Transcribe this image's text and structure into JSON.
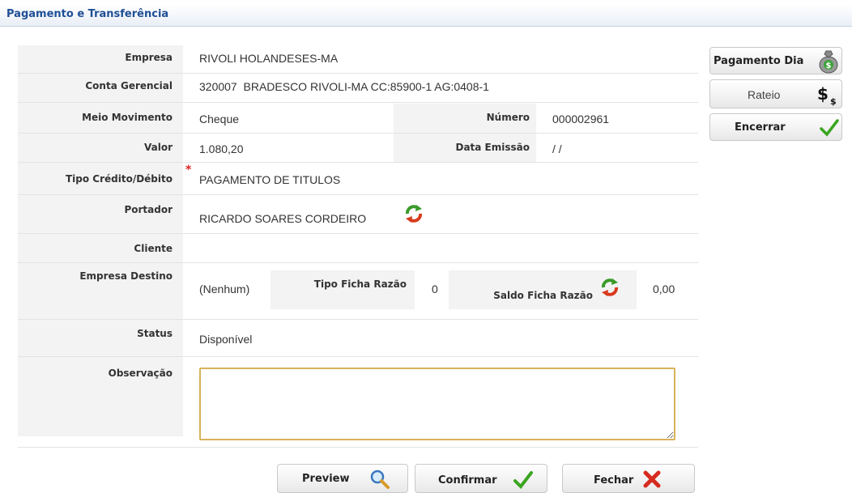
{
  "window": {
    "title": "Pagamento e Transferência"
  },
  "form": {
    "empresa": {
      "label": "Empresa",
      "value": "RIVOLI HOLANDESES-MA"
    },
    "conta_gerencial": {
      "label": "Conta Gerencial",
      "value": "320007  BRADESCO RIVOLI-MA CC:85900-1 AG:0408-1"
    },
    "meio_movimento": {
      "label": "Meio Movimento",
      "value": "Cheque"
    },
    "numero": {
      "label": "Número",
      "value": "000002961"
    },
    "valor": {
      "label": "Valor",
      "value": "1.080,20"
    },
    "data_emissao": {
      "label": "Data Emissão",
      "value": "/ /"
    },
    "tipo_credito_debito": {
      "label": "Tipo Crédito/Débito",
      "value": "PAGAMENTO DE TITULOS",
      "required_mark": "*"
    },
    "portador": {
      "label": "Portador",
      "value": "RICARDO SOARES CORDEIRO"
    },
    "cliente": {
      "label": "Cliente",
      "value": ""
    },
    "empresa_destino": {
      "label": "Empresa Destino",
      "value": "(Nenhum)"
    },
    "tipo_ficha_razao": {
      "label": "Tipo Ficha Razão",
      "value": "0"
    },
    "saldo_ficha_razao": {
      "label": "Saldo Ficha Razão",
      "value": "0,00"
    },
    "status": {
      "label": "Status",
      "value": "Disponível"
    },
    "observacao": {
      "label": "Observação",
      "value": ""
    }
  },
  "side_buttons": {
    "pagamento_dia": "Pagamento Dia",
    "rateio": "Rateio",
    "encerrar": "Encerrar"
  },
  "footer_buttons": {
    "preview": "Preview",
    "confirmar": "Confirmar",
    "fechar": "Fechar"
  },
  "colors": {
    "title": "#1f4e95",
    "required": "#e02020",
    "confirm": "#3aa520",
    "close": "#d62b1f"
  },
  "icons": [
    "refresh-icon",
    "money-bag-icon",
    "dollar-icon",
    "check-icon",
    "magnifier-icon",
    "x-icon"
  ]
}
